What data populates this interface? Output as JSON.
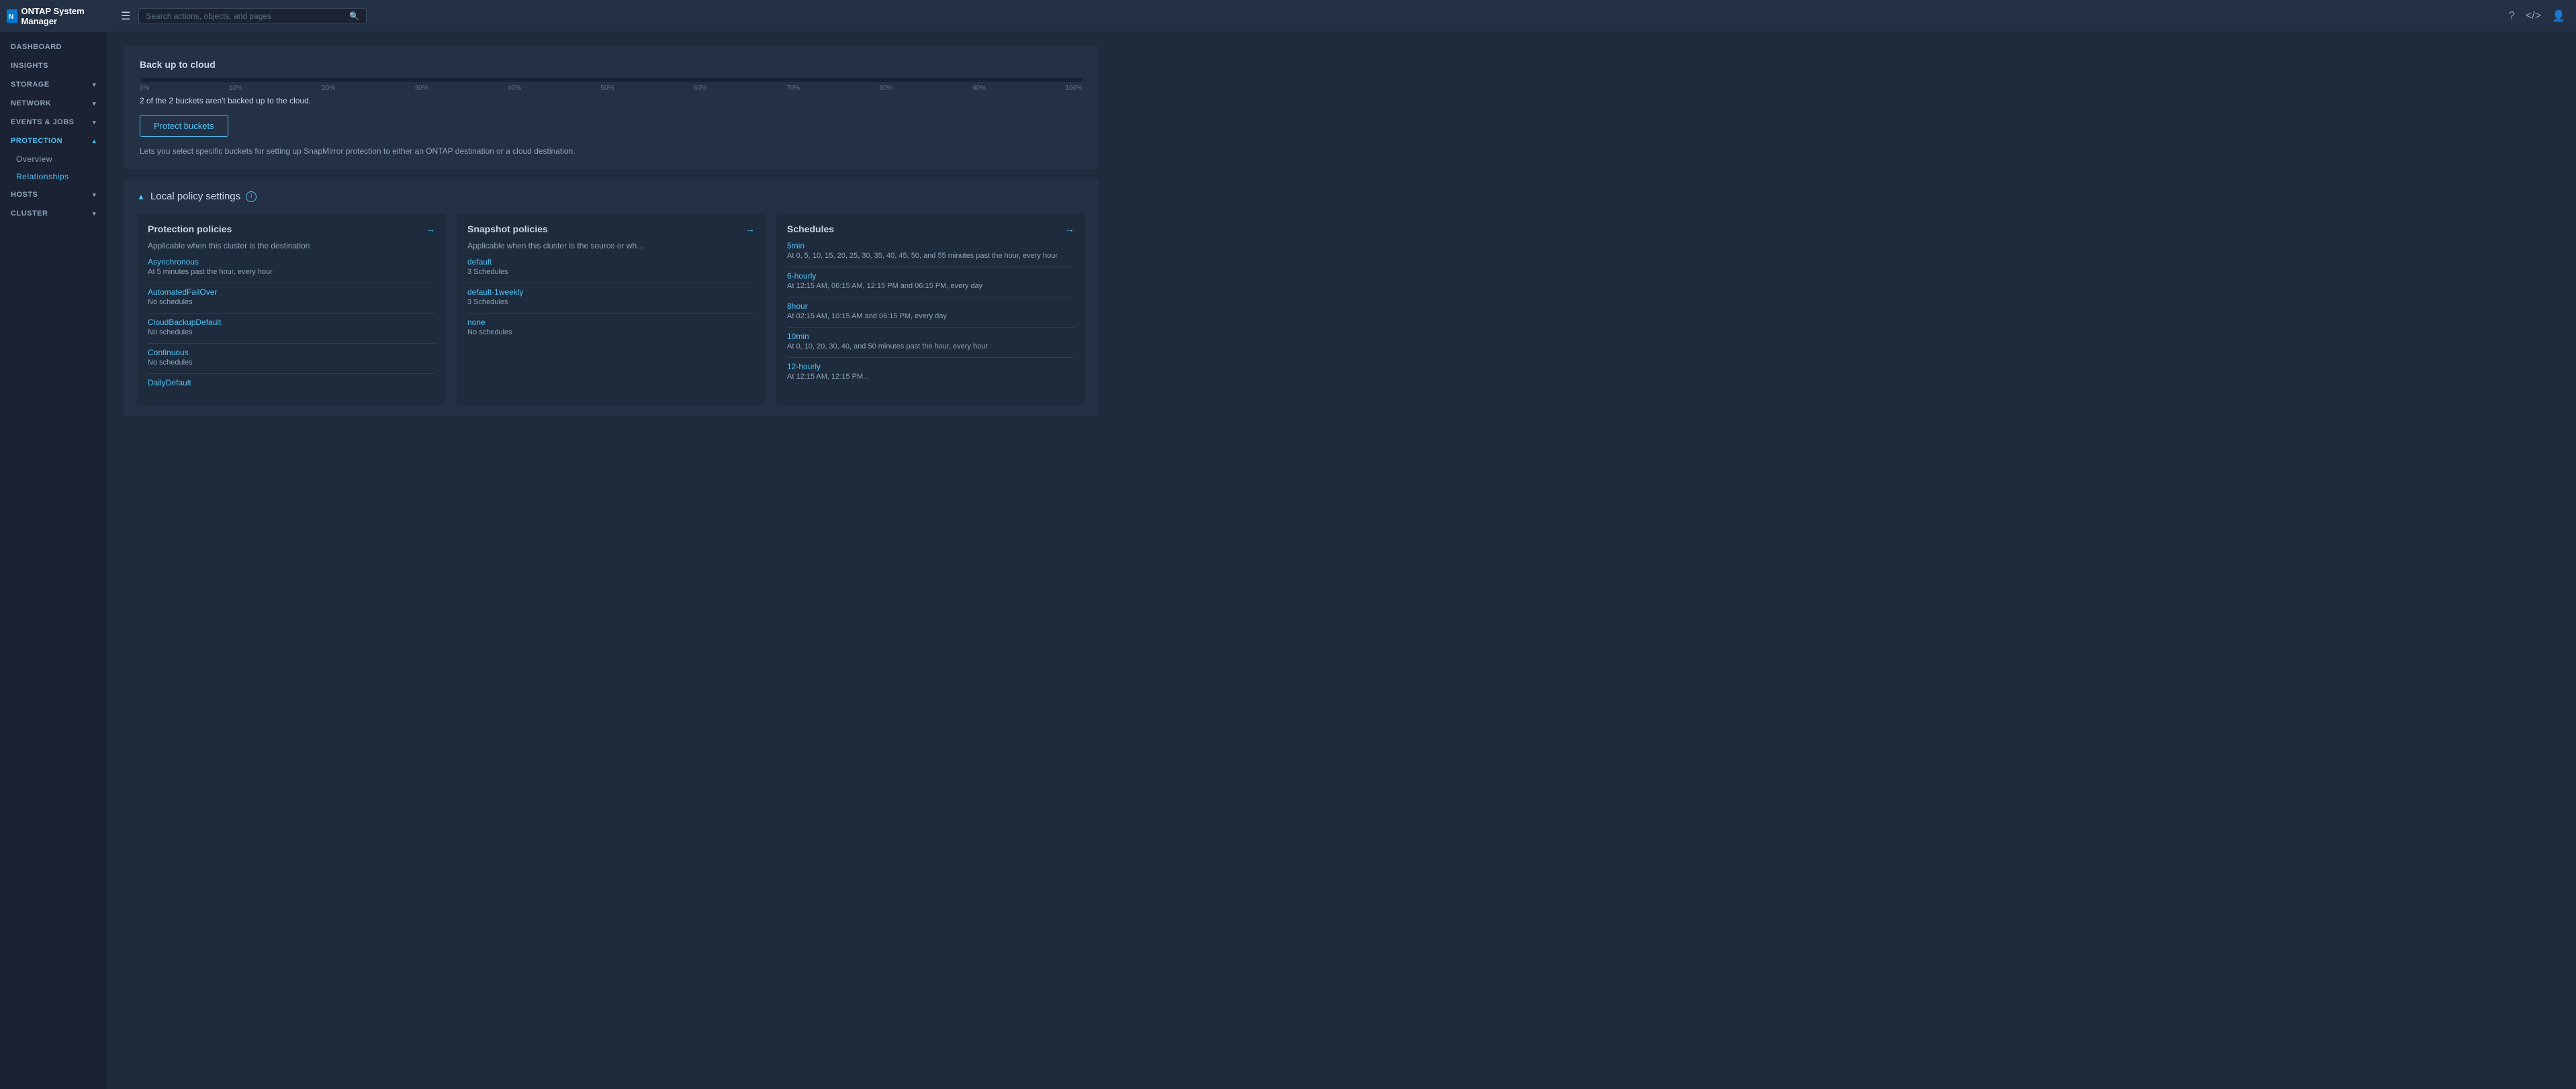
{
  "app": {
    "title": "ONTAP System Manager",
    "logo_text": "N"
  },
  "topbar": {
    "search_placeholder": "Search actions, objects, and pages",
    "icons": [
      "help-icon",
      "code-icon",
      "settings-icon"
    ]
  },
  "sidebar": {
    "items": [
      {
        "id": "dashboard",
        "label": "DASHBOARD",
        "expandable": false
      },
      {
        "id": "insights",
        "label": "INSIGHTS",
        "expandable": false
      },
      {
        "id": "storage",
        "label": "STORAGE",
        "expandable": true
      },
      {
        "id": "network",
        "label": "NETWORK",
        "expandable": true
      },
      {
        "id": "events-jobs",
        "label": "EVENTS & JOBS",
        "expandable": true
      },
      {
        "id": "protection",
        "label": "PROTECTION",
        "expandable": true,
        "active": true
      },
      {
        "id": "overview",
        "label": "Overview",
        "sub": true
      },
      {
        "id": "relationships",
        "label": "Relationships",
        "sub": true
      },
      {
        "id": "hosts",
        "label": "HOSTS",
        "expandable": true
      },
      {
        "id": "cluster",
        "label": "CLUSTER",
        "expandable": true
      }
    ]
  },
  "backup_section": {
    "title": "Back up to cloud",
    "progress_labels": [
      "0%",
      "10%",
      "20%",
      "30%",
      "40%",
      "50%",
      "60%",
      "70%",
      "80%",
      "90%",
      "100%"
    ],
    "progress_info": "2 of the  2 buckets aren't backed up to the cloud.",
    "protect_btn_label": "Protect buckets",
    "description": "Lets you select specific buckets for setting up SnapMirror protection to either an ONTAP destination or a cloud destination."
  },
  "local_policy": {
    "title": "Local policy settings",
    "collapse_symbol": "▲",
    "info_symbol": "i",
    "cards": [
      {
        "id": "protection-policies",
        "title": "Protection policies",
        "subtitle": "Applicable when this cluster is the destination",
        "items": [
          {
            "name": "Asynchronous",
            "desc": "At 5 minutes past the hour, every hour"
          },
          {
            "name": "AutomatedFailOver",
            "desc": "No schedules"
          },
          {
            "name": "CloudBackupDefault",
            "desc": "No schedules"
          },
          {
            "name": "Continuous",
            "desc": "No schedules"
          },
          {
            "name": "DailyDefault",
            "desc": ""
          }
        ]
      },
      {
        "id": "snapshot-policies",
        "title": "Snapshot policies",
        "subtitle": "Applicable when this cluster is the source or wh...",
        "items": [
          {
            "name": "default",
            "desc": "3 Schedules"
          },
          {
            "name": "default-1weekly",
            "desc": "3 Schedules"
          },
          {
            "name": "none",
            "desc": "No schedules"
          }
        ]
      },
      {
        "id": "schedules",
        "title": "Schedules",
        "subtitle": "",
        "items": [
          {
            "name": "5min",
            "desc": "At 0, 5, 10, 15, 20, 25, 30, 35, 40, 45, 50, and 55 minutes past the hour, every hour"
          },
          {
            "name": "6-hourly",
            "desc": "At 12:15 AM, 06:15 AM, 12:15 PM and 06:15 PM, every day"
          },
          {
            "name": "8hour",
            "desc": "At 02:15 AM, 10:15 AM and 06:15 PM, every day"
          },
          {
            "name": "10min",
            "desc": "At 0, 10, 20, 30, 40, and 50 minutes past the hour, every hour"
          },
          {
            "name": "12-hourly",
            "desc": "At 12:15 AM, 12:15 PM..."
          }
        ]
      }
    ]
  }
}
